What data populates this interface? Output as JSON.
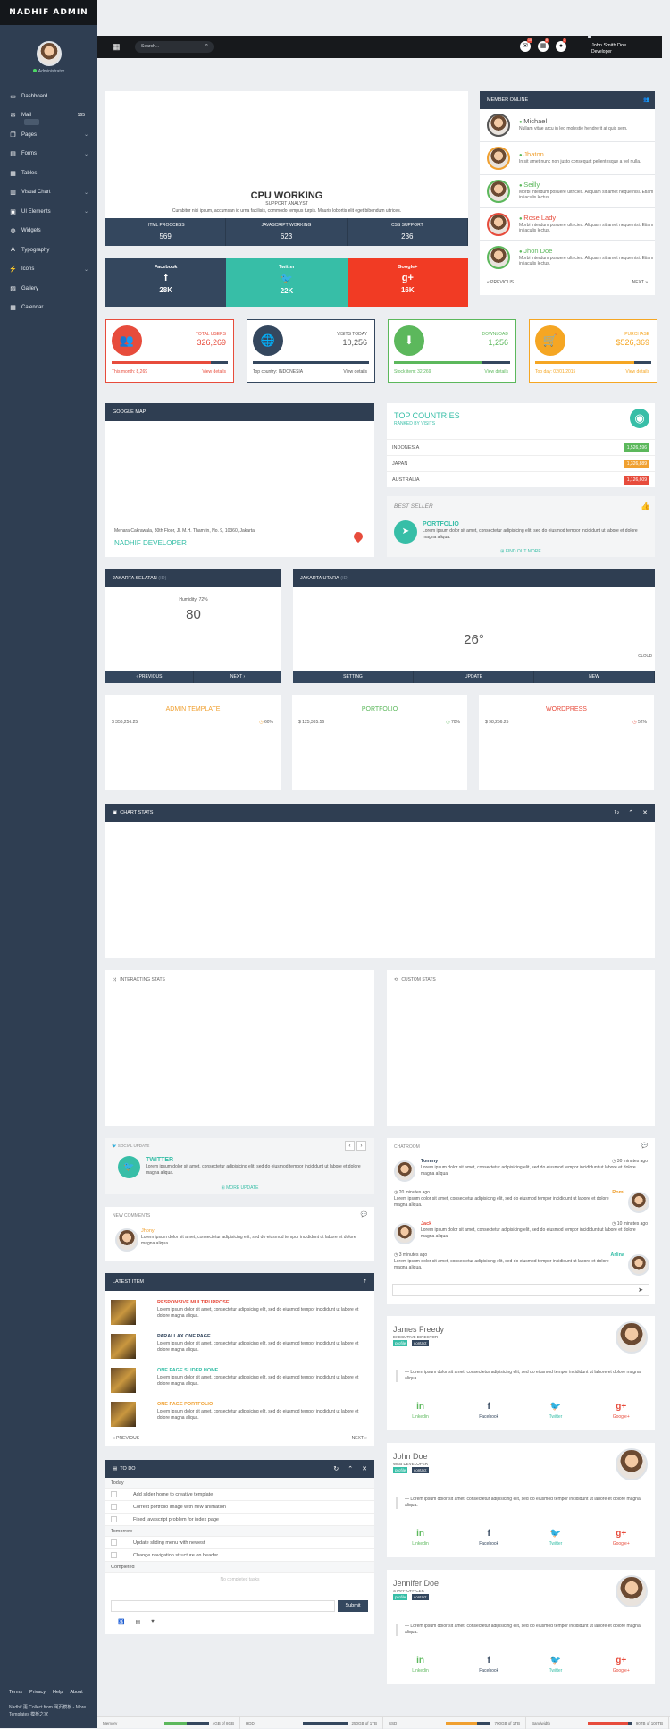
{
  "brand": "NADHIF ADMIN",
  "user": {
    "role": "Administrator",
    "name": "John Smith Doe",
    "title": "Developer"
  },
  "sidebar": {
    "items": [
      {
        "label": "Dashboard",
        "icon": "laptop-icon"
      },
      {
        "label": "Mail",
        "icon": "mail-icon",
        "count": "165"
      },
      {
        "label": "Pages",
        "icon": "pages-icon"
      },
      {
        "label": "Forms",
        "icon": "forms-icon"
      },
      {
        "label": "Tables",
        "icon": "tables-icon"
      },
      {
        "label": "Visual Chart",
        "icon": "chart-icon"
      },
      {
        "label": "UI Elements",
        "icon": "ui-icon"
      },
      {
        "label": "Widgets",
        "icon": "globe-icon"
      },
      {
        "label": "Typography",
        "icon": "text-icon"
      },
      {
        "label": "Icons",
        "icon": "bolt-icon"
      },
      {
        "label": "Gallery",
        "icon": "image-icon"
      },
      {
        "label": "Calendar",
        "icon": "calendar-icon"
      }
    ],
    "footer": [
      "Terms",
      "Privacy",
      "Help",
      "About"
    ],
    "copyright": "Nadhif 更 Collect from 网页模板 - More Templates 模板之家"
  },
  "topbar": {
    "search_placeholder": "Search...",
    "badges": [
      "10",
      "8",
      "3"
    ]
  },
  "cpu": {
    "title": "CPU WORKING",
    "subtitle": "SUPPORT ANALYST",
    "desc": "Curabitur nisi ipsum, accumsan id urna facilisis, commodo tempus turpis. Mauris lobortis elit eget bibendum ultrices.",
    "stats": [
      {
        "label": "HTML PROCCESS",
        "value": "569"
      },
      {
        "label": "JAVASCRIPT WORKING",
        "value": "623"
      },
      {
        "label": "CSS SUPPORT",
        "value": "236"
      }
    ]
  },
  "social": [
    {
      "label": "Facebook",
      "icon": "f",
      "value": "28K",
      "color": "#34475e"
    },
    {
      "label": "Twitter",
      "icon": "🐦",
      "value": "22K",
      "color": "#37bea7"
    },
    {
      "label": "Google+",
      "icon": "g+",
      "value": "16K",
      "color": "#f13b24"
    }
  ],
  "members": {
    "title": "MEMBER ONLINE",
    "prev": "« PREVIOUS",
    "next": "NEXT »",
    "items": [
      {
        "name": "Michael",
        "text": "Nullam vitae arcu in leo molestie hendrerit at quis sem.",
        "color": "#555",
        "border": "#555"
      },
      {
        "name": "Jhaton",
        "text": "In sit amet nunc non justo consequat pellentesque a vel nulla.",
        "color": "#f0a030",
        "border": "#f0a030"
      },
      {
        "name": "Seilly",
        "text": "Morbi interdum posuere ultricies. Aliquam sit amet neque nisi. Etiam in iaculis lectus.",
        "color": "#5cb85c",
        "border": "#5cb85c"
      },
      {
        "name": "Rose Lady",
        "text": "Morbi interdum posuere ultricies. Aliquam sit amet neque nisi. Etiam in iaculis lectus.",
        "color": "#e74c3c",
        "border": "#e74c3c"
      },
      {
        "name": "Jhon Doe",
        "text": "Morbi interdum posuere ultricies. Aliquam sit amet neque nisi. Etiam in iaculis lectus.",
        "color": "#5cb85c",
        "border": "#5cb85c"
      }
    ]
  },
  "tiles": [
    {
      "label": "TOTAL USERS",
      "value": "326,269",
      "foot": "This month: 8,269",
      "link": "View details",
      "color": "#e74c3c",
      "icon": "👥",
      "fill": 0.85
    },
    {
      "label": "VISITS TODAY",
      "value": "10,256",
      "foot": "Top country: INDONESIA",
      "link": "View details",
      "color": "#34475e",
      "icon": "🌐",
      "fill": 0.7
    },
    {
      "label": "DOWNLOAD",
      "value": "1,256",
      "foot": "Stock item: 32,269",
      "link": "View details",
      "color": "#5cb85c",
      "icon": "⬇",
      "fill": 0.75
    },
    {
      "label": "PURCHASE",
      "value": "$526,369",
      "foot": "Top day: 02/01/2015",
      "link": "View details",
      "color": "#f5a623",
      "icon": "🛒",
      "fill": 0.85
    }
  ],
  "map": {
    "title": "GOOGLE MAP",
    "address": "Menara Cakrawala, 80th Floor, Jl. M.H. Thamrin, No. 9, 10360, Jakarta",
    "name": "NADHIF DEVELOPER"
  },
  "countries": {
    "title": "TOP COUNTRIES",
    "subtitle": "RANKED BY VISITS",
    "rows": [
      {
        "name": "INDONESIA",
        "value": "1,526,596",
        "color": "#5cb85c"
      },
      {
        "name": "JAPAN",
        "value": "1,326,889",
        "color": "#f0a030"
      },
      {
        "name": "AUSTRALIA",
        "value": "1,126,609",
        "color": "#e74c3c"
      }
    ]
  },
  "seller": {
    "title": "BEST SELLER",
    "item": "PORTFOLIO",
    "text": "Lorem ipsum dolor sit amet, consectetur adipisicing elit, sed do eiusmod tempor incididunt ut labore et dolore magna aliqua.",
    "link": "FIND OUT MORE"
  },
  "weather1": {
    "title": "JAKARTA SELATAN",
    "tag": "(ID)",
    "humidity": "Humidity: 72%",
    "value": "80",
    "prev": "‹ PREVIOUS",
    "next": "NEXT ›"
  },
  "weather2": {
    "title": "JAKARTA UTARA",
    "tag": "(ID)",
    "value": "26°",
    "label": "CLOUD",
    "tabs": [
      "SETTING",
      "UPDATE",
      "NEW"
    ]
  },
  "products": [
    {
      "title": "ADMIN TEMPLATE",
      "price": "$ 356,256.25",
      "pct": "60%",
      "color": "#f0a030"
    },
    {
      "title": "PORTFOLIO",
      "price": "$ 125,365.56",
      "pct": "70%",
      "color": "#5cb85c"
    },
    {
      "title": "WORDPRESS",
      "price": "$ 98,256.25",
      "pct": "52%",
      "color": "#e74c3c"
    }
  ],
  "chartstats": {
    "title": "CHART STATS"
  },
  "interacting": {
    "title": "INTERACTING STATS"
  },
  "custom": {
    "title": "CUSTOM STATS"
  },
  "socialupdate": {
    "title": "SOCIAL UPDATE",
    "name": "TWITTER",
    "text": "Lorem ipsum dolor sit amet, consectetur adipisicing elit, sed do eiusmod tempor incididunt ut labore et dolore magna aliqua.",
    "link": "MORE UPDATE"
  },
  "comments": {
    "title": "NEW COMMENTS",
    "name": "Jhony",
    "text": "Lorem ipsum dolor sit amet, consectetur adipisicing elit, sed do eiusmod tempor incididunt ut labore et dolore magna aliqua."
  },
  "latest": {
    "title": "LATEST ITEM",
    "prev": "« PREVIOUS",
    "next": "NEXT »",
    "items": [
      {
        "title": "RESPONSIVE MULTIPURPOSE",
        "color": "#e74c3c",
        "text": "Lorem ipsum dolor sit amet, consectetur adipisicing elit, sed do eiusmod tempor incididunt ut labore et dolore magna aliqua."
      },
      {
        "title": "PARALLAX ONE PAGE",
        "color": "#34475e",
        "text": "Lorem ipsum dolor sit amet, consectetur adipisicing elit, sed do eiusmod tempor incididunt ut labore et dolore magna aliqua."
      },
      {
        "title": "ONE PAGE SLIDER HOME",
        "color": "#37bea7",
        "text": "Lorem ipsum dolor sit amet, consectetur adipisicing elit, sed do eiusmod tempor incididunt ut labore et dolore magna aliqua."
      },
      {
        "title": "ONE PAGE PORTFOLIO",
        "color": "#f0a030",
        "text": "Lorem ipsum dolor sit amet, consectetur adipisicing elit, sed do eiusmod tempor incididunt ut labore et dolore magna aliqua."
      }
    ]
  },
  "todo": {
    "title": "TO DO",
    "today": "Today",
    "tomorrow": "Tomorrow",
    "completed": "Completed",
    "none": "No completed tasks",
    "submit": "Submit",
    "items_today": [
      "Add slider home to creative template",
      "Correct portfolio image with new animation",
      "Fixed javascript problem for index page"
    ],
    "items_tomorrow": [
      "Update sliding menu with newest",
      "Change navigation structure on header"
    ]
  },
  "chat": {
    "title": "CHATROOM",
    "msgs": [
      {
        "name": "Tommy",
        "time": "30 minutes ago",
        "text": "Lorem ipsum dolor sit amet, consectetur adipisicing elit, sed do eiusmod tempor incididunt ut labore et dolore magna aliqua.",
        "side": "left",
        "color": "#34475e"
      },
      {
        "name": "Romi",
        "time": "20 minutes ago",
        "text": "Lorem ipsum dolor sit amet, consectetur adipisicing elit, sed do eiusmod tempor incididunt ut labore et dolore magna aliqua.",
        "side": "right",
        "color": "#f0a030"
      },
      {
        "name": "Jack",
        "time": "10 minutes ago",
        "text": "Lorem ipsum dolor sit amet, consectetur adipisicing elit, sed do eiusmod tempor incididunt ut labore et dolore magna aliqua.",
        "side": "left",
        "color": "#e74c3c"
      },
      {
        "name": "Arlina",
        "time": "3 minutes ago",
        "text": "Lorem ipsum dolor sit amet, consectetur adipisicing elit, sed do eiusmod tempor incididunt ut labore et dolore magna aliqua.",
        "side": "right",
        "color": "#37bea7"
      }
    ]
  },
  "profiles": [
    {
      "name": "James Freedy",
      "role": "EXECUTIVE DIRECTOR",
      "text": "— Lorem ipsum dolor sit amet, consectetur adipisicing elit, sed do eiusmod tempor incididunt ut labore et dolore magna aliqua."
    },
    {
      "name": "John Doe",
      "role": "WEB DEVELOPER",
      "text": "— Lorem ipsum dolor sit amet, consectetur adipisicing elit, sed do eiusmod tempor incididunt ut labore et dolore magna aliqua."
    },
    {
      "name": "Jennifer Doe",
      "role": "STAFF OFFICER",
      "text": "— Lorem ipsum dolor sit amet, consectetur adipisicing elit, sed do eiusmod tempor incididunt ut labore et dolore magna aliqua."
    }
  ],
  "profile_tags": [
    "profile",
    "contact"
  ],
  "profile_social": [
    "Linkedin",
    "Facebook",
    "Twitter",
    "Google+"
  ],
  "footer": [
    {
      "label": "Memory",
      "value": "4GB of 8GB",
      "color": "#5cb85c",
      "fill": 0.5
    },
    {
      "label": "HDD",
      "value": "250GB of 1TB",
      "color": "#34475e",
      "fill": 0.25
    },
    {
      "label": "SSD",
      "value": "700GB of 1TB",
      "color": "#f0a030",
      "fill": 0.7
    },
    {
      "label": "Bandwidth",
      "value": "90TB of 100TB",
      "color": "#e74c3c",
      "fill": 0.9
    }
  ]
}
